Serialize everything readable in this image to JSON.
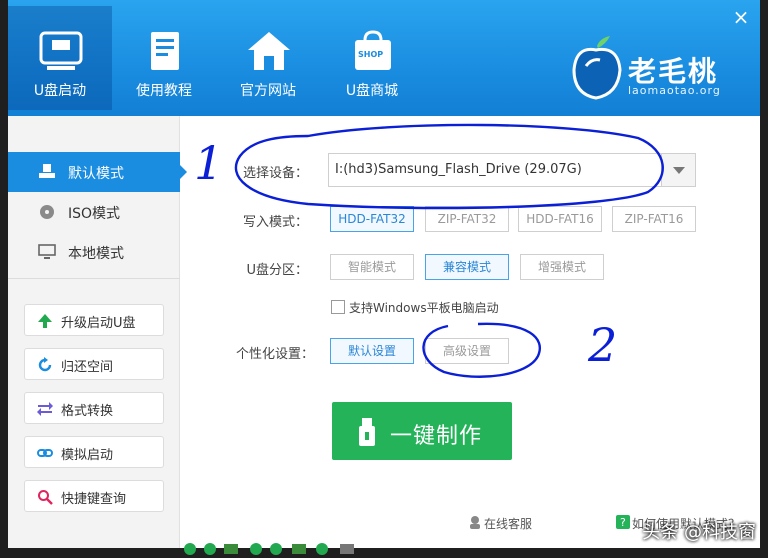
{
  "nav": [
    {
      "label": "U盘启动",
      "icon": "usb-drive-icon"
    },
    {
      "label": "使用教程",
      "icon": "book-icon"
    },
    {
      "label": "官方网站",
      "icon": "home-icon"
    },
    {
      "label": "U盘商城",
      "icon": "shop-bag-icon",
      "badge": "SHOP"
    }
  ],
  "logo": {
    "name": "老毛桃",
    "url": "laomaotao.org"
  },
  "window": {
    "close": "×"
  },
  "modes": [
    {
      "label": "默认模式",
      "icon": "usb-icon",
      "active": true
    },
    {
      "label": "ISO模式",
      "icon": "disc-icon",
      "active": false
    },
    {
      "label": "本地模式",
      "icon": "monitor-icon",
      "active": false
    }
  ],
  "tools": [
    {
      "label": "升级启动U盘",
      "icon": "arrow-up-icon",
      "color": "#22a94f"
    },
    {
      "label": "归还空间",
      "icon": "refresh-icon",
      "color": "#1a8de0"
    },
    {
      "label": "格式转换",
      "icon": "swap-icon",
      "color": "#6b5bd6"
    },
    {
      "label": "模拟启动",
      "icon": "link-icon",
      "color": "#1a8de0"
    },
    {
      "label": "快捷键查询",
      "icon": "search-icon",
      "color": "#e0245e"
    }
  ],
  "form": {
    "device_label": "选择设备：",
    "device_value": "I:(hd3)Samsung_Flash_Drive (29.07G)",
    "write_label": "写入模式：",
    "write_options": [
      "HDD-FAT32",
      "ZIP-FAT32",
      "HDD-FAT16",
      "ZIP-FAT16"
    ],
    "partition_label": "U盘分区：",
    "partition_options": [
      "智能模式",
      "兼容模式",
      "增强模式"
    ],
    "windows_tablet": "支持Windows平板电脑启动",
    "personal_label": "个性化设置：",
    "personal_options": [
      "默认设置",
      "高级设置"
    ],
    "make_button": "一键制作"
  },
  "footer": {
    "service": "在线客服",
    "help": "如何使用默认模式？"
  },
  "annotations": {
    "one": "1",
    "two": "2"
  },
  "watermark": "头条 @科技窗",
  "colors": {
    "accent": "#1a8de0",
    "green": "#25b35a",
    "ink": "#0a1fd6"
  }
}
